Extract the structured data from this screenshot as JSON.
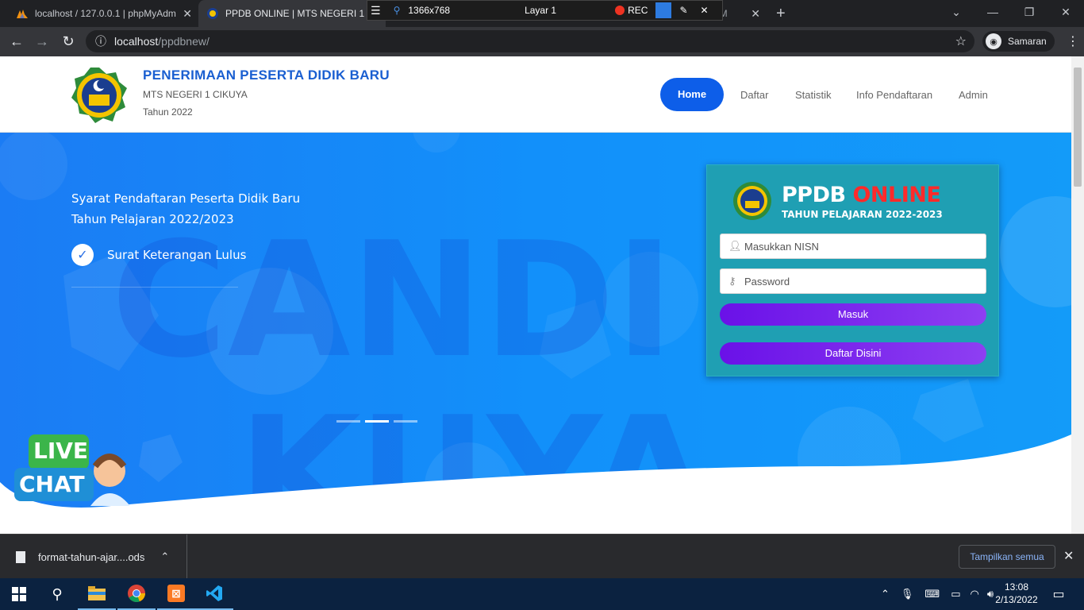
{
  "browser": {
    "tabs": [
      {
        "title": "localhost / 127.0.0.1 | phpMyAdm",
        "active": false
      },
      {
        "title": "PPDB ONLINE | MTS NEGERI 1 C",
        "active": true
      },
      {
        "title": "pM",
        "active": false
      }
    ],
    "recorder": {
      "resolution": "1366x768",
      "layer": "Layar 1",
      "rec_label": "REC"
    },
    "url_host": "localhost",
    "url_path": "/ppdbnew/",
    "profile_label": "Samaran"
  },
  "site": {
    "title": "PENERIMAAN PESERTA DIDIK BARU",
    "school": "MTS NEGERI 1 CIKUYA",
    "year": "Tahun 2022",
    "nav": [
      "Home",
      "Daftar",
      "Statistik",
      "Info Pendaftaran",
      "Admin"
    ],
    "logo_text": "MTs NEGERI 1"
  },
  "hero": {
    "title_line1": "Syarat Pendaftaran Peserta Didik Baru",
    "title_line2": "Tahun Pelajaran 2022/2023",
    "requirement": "Surat Keterangan Lulus",
    "slides": 3,
    "active_slide": 2,
    "watermark_line1": "CANDI",
    "watermark_line2": "KUYA"
  },
  "login": {
    "title_white": "PPDB ",
    "title_red": "ONLINE",
    "subtitle": "TAHUN PELAJARAN 2022-2023",
    "nisn_placeholder": "Masukkan NISN",
    "password_placeholder": "Password",
    "submit_label": "Masuk",
    "register_label": "Daftar Disini"
  },
  "chat": {
    "line1": "LIVE",
    "line2": "CHAT"
  },
  "downloads": {
    "file": "format-tahun-ajar....ods",
    "show_all": "Tampilkan semua"
  },
  "taskbar": {
    "time": "13:08",
    "date": "2/13/2022"
  },
  "colors": {
    "accent": "#0d5ee9",
    "hero": "#1290fa",
    "login_card": "#1f9fb3",
    "button": "#7b2ff0"
  }
}
